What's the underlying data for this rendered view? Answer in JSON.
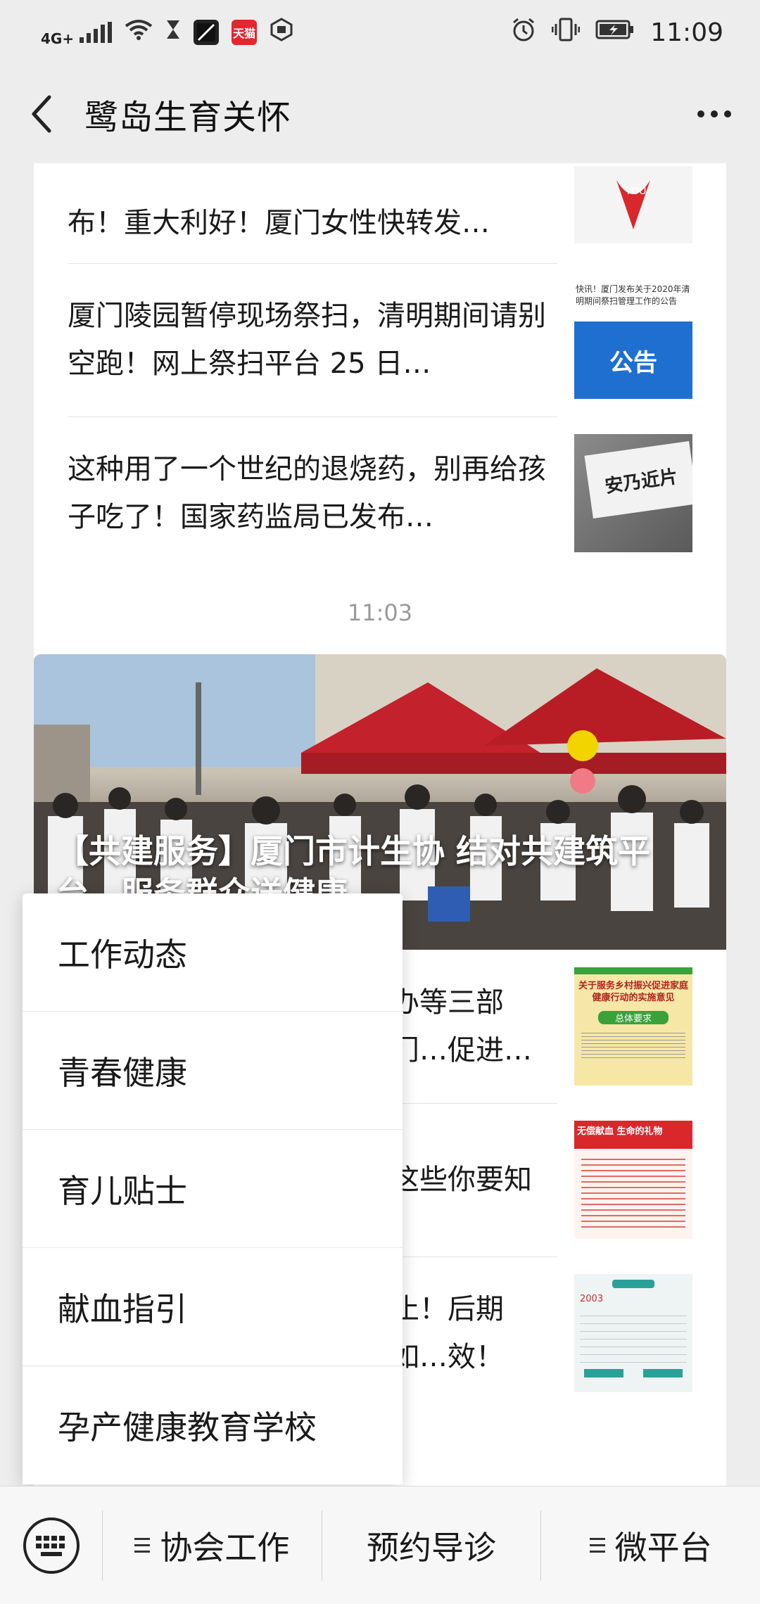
{
  "status_bar": {
    "network": "4G+",
    "time": "11:09",
    "app_badge": "天猫"
  },
  "nav": {
    "title": "鹭岛生育关怀"
  },
  "card1": {
    "articles": [
      {
        "title": "布！重大利好！厦门女性快转发…"
      },
      {
        "title": "厦门陵园暂停现场祭扫，清明期间请别空跑！网上祭扫平台 25 日…",
        "thumb_caption": "快讯！厦门发布关于2020年清明期间祭扫管理工作的公告",
        "thumb_label": "公告"
      },
      {
        "title": "这种用了一个世纪的退烧药，别再给孩子吃了！国家药监局已发布…",
        "thumb_label": "安乃近片"
      }
    ],
    "top_thumb_label": "YOU"
  },
  "timestamp": "11:03",
  "card2": {
    "hero_title": "【共建服务】厦门市计生协 结对共建筑平台，服务群众送健康",
    "articles": [
      {
        "title_visible": "办等三部门…促进家…",
        "thumb_caption": "关于服务乡村振兴促进家庭健康行动的实施意见",
        "thumb_label": "总体要求"
      },
      {
        "title_visible": "这些你要知",
        "thumb_caption": "无偿献血 生命的礼物"
      },
      {
        "title_visible": "止！后期如…效！",
        "thumb_label": "2003"
      }
    ]
  },
  "popup_menu": {
    "items": [
      "工作动态",
      "青春健康",
      "育儿贴士",
      "献血指引",
      "孕产健康教育学校"
    ]
  },
  "bottom_menu": {
    "items": [
      "协会工作",
      "预约导诊",
      "微平台"
    ]
  },
  "colors": {
    "background": "#ededed",
    "card": "#ffffff",
    "accent_red": "#d8282b",
    "notice_blue": "#1f6fd1"
  }
}
